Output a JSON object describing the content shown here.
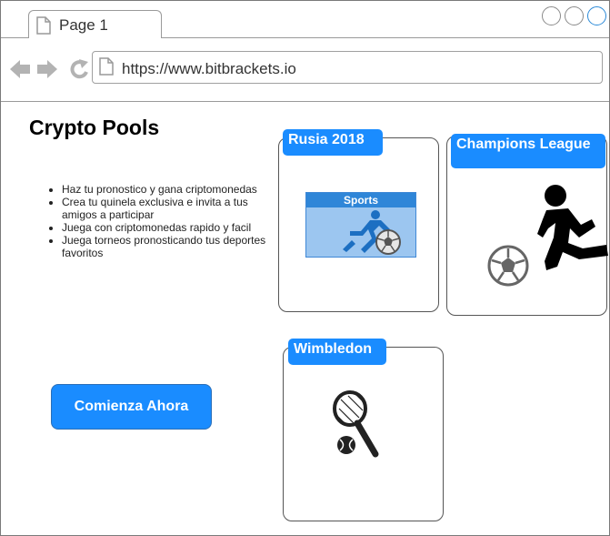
{
  "browser": {
    "tab_title": "Page 1",
    "url": "https://www.bitbrackets.io"
  },
  "page": {
    "title": "Crypto Pools",
    "features": [
      "Haz tu pronostico y gana criptomonedas",
      "Crea tu quinela exclusiva e invita a tus amigos a participar",
      "Juega con criptomonedas rapido y facil",
      "Juega torneos pronosticando tus deportes favoritos"
    ],
    "cta_label": "Comienza Ahora"
  },
  "cards": {
    "rusia": {
      "label": "Rusia 2018",
      "widget_title": "Sports"
    },
    "champions": {
      "label": "Champions League"
    },
    "wimbledon": {
      "label": "Wimbledon"
    }
  },
  "colors": {
    "accent": "#1a8cff",
    "border": "#555555"
  }
}
